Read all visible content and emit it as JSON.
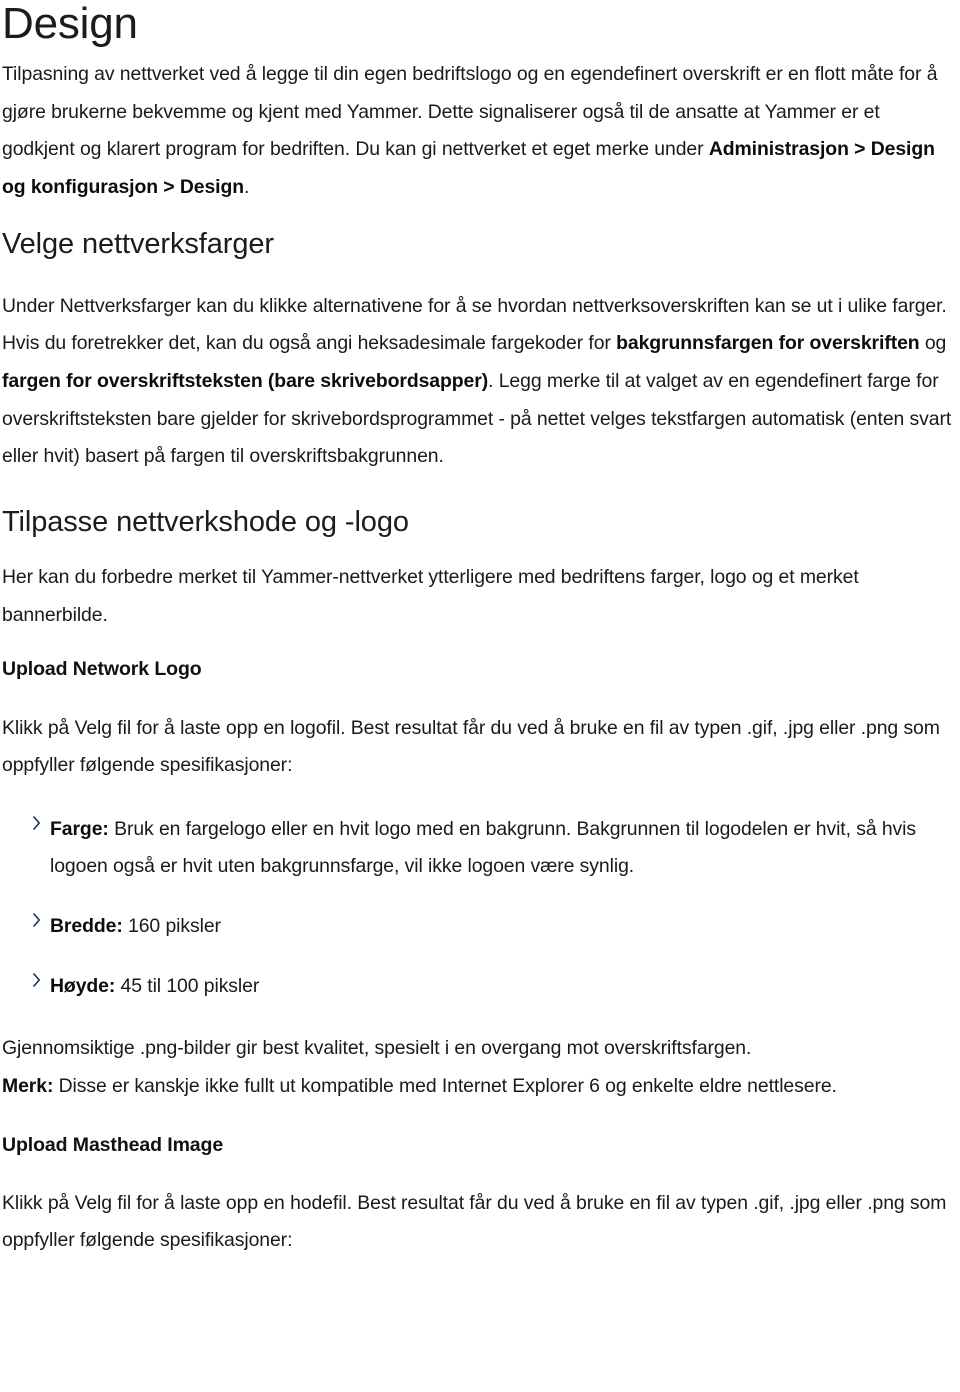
{
  "document": {
    "title": "Design",
    "intro": {
      "text_before_bold": "Tilpasning av nettverket ved å legge til din egen bedriftslogo og en egendefinert overskrift er en flott måte for å gjøre brukerne bekvemme og kjent med Yammer. Dette signaliserer også til de ansatte at Yammer er et godkjent og klarert program for bedriften. Du kan gi nettverket et eget merke under ",
      "bold_path": "Administrasjon > Design og konfigurasjon > Design",
      "text_after_bold": "."
    },
    "section_colors": {
      "heading": "Velge nettverksfarger",
      "para_1_before": "Under Nettverksfarger kan du klikke alternativene for å se hvordan nettverksoverskriften kan se ut i ulike farger. Hvis du foretrekker det, kan du også angi heksadesimale fargekoder for ",
      "bold_1": "bakgrunnsfargen for overskriften",
      "mid_1": " og ",
      "bold_2": "fargen for overskriftsteksten (bare skrivebordsapper)",
      "para_1_after": ". Legg merke til at valget av en egendefinert farge for overskriftsteksten bare gjelder for skrivebordsprogrammet - på nettet velges tekstfargen automatisk (enten svart eller hvit) basert på fargen til overskriftsbakgrunnen."
    },
    "section_header_logo": {
      "heading": "Tilpasse nettverkshode og -logo",
      "paragraph": "Her kan du forbedre merket til Yammer-nettverket ytterligere med bedriftens farger, logo og et merket bannerbilde.",
      "subheading": "Upload Network Logo",
      "instructions": "Klikk på Velg fil for å laste opp en logofil. Best resultat får du ved å bruke en fil av typen .gif, .jpg eller .png som oppfyller følgende spesifikasjoner:",
      "specs": [
        {
          "bullet_icon": "chevron-right-icon",
          "label": "Farge:",
          "value": " Bruk en fargelogo eller en hvit logo med en bakgrunn. Bakgrunnen til logodelen er hvit, så hvis logoen også er hvit uten bakgrunnsfarge, vil ikke logoen være synlig."
        },
        {
          "bullet_icon": "chevron-right-icon",
          "label": "Bredde:",
          "value": " 160 piksler"
        },
        {
          "bullet_icon": "chevron-right-icon",
          "label": "Høyde:",
          "value": " 45 til 100 piksler"
        }
      ],
      "note_line_1": "Gjennomsiktige .png-bilder gir best kvalitet, spesielt i en overgang mot overskriftsfargen.",
      "note_label": "Merk:",
      "note_text": " Disse er kanskje ikke fullt ut kompatible med Internet Explorer 6 og enkelte eldre nettlesere."
    },
    "section_masthead": {
      "subheading": "Upload Masthead Image",
      "instructions": "Klikk på Velg fil for å laste opp en hodefil. Best resultat får du ved å bruke en fil av typen .gif, .jpg eller .png som oppfyller følgende spesifikasjoner:"
    }
  },
  "colors": {
    "page_background": "#ffffff",
    "body_text": "#1a1a1a",
    "heading_text": "#1c1c1c",
    "bullet_chevron": "#1f3864"
  }
}
